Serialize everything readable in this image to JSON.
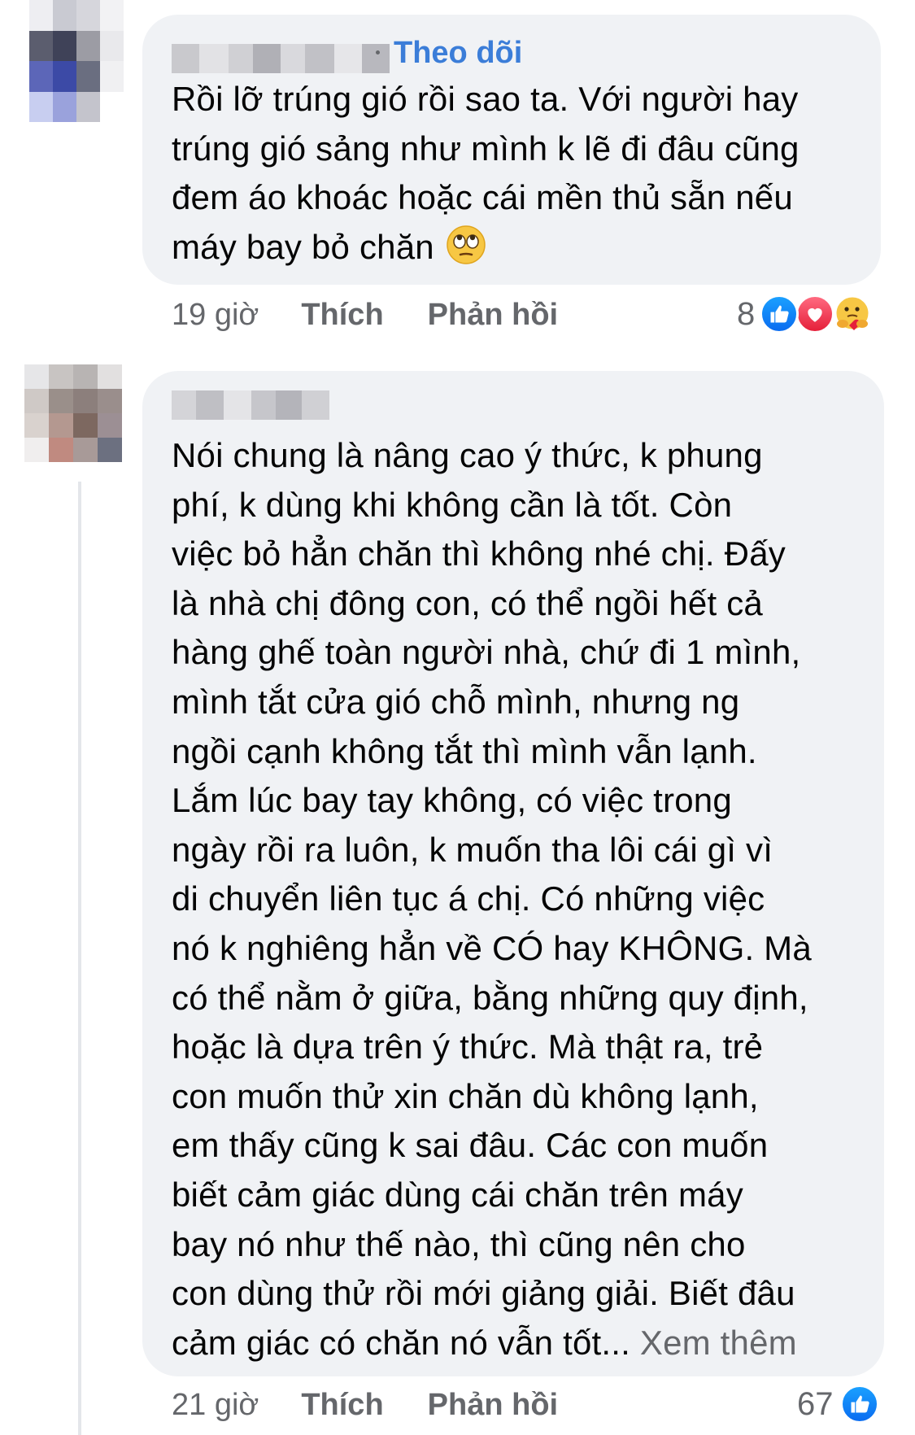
{
  "comments": [
    {
      "follow_label": "Theo dõi",
      "text": "Rồi lỡ trúng gió rồi sao ta. Với người hay\ntrúng gió sảng như mình k lẽ đi đâu cũng\nđem áo khoác hoặc cái mền thủ sẵn nếu\nmáy bay bỏ chăn",
      "emoji": "face-with-rolling-eyes-icon",
      "time": "19 giờ",
      "like_label": "Thích",
      "reply_label": "Phản hồi",
      "reaction_count": "8",
      "reactions": [
        "like-icon",
        "love-icon",
        "care-icon"
      ]
    },
    {
      "text": "Nói chung là nâng cao ý thức, k phung\nphí, k dùng khi không cần là tốt. Còn\nviệc bỏ hẳn chăn thì không nhé chị. Đấy\nlà nhà chị đông con, có thể ngồi hết cả\nhàng ghế toàn người nhà, chứ đi 1 mình,\nmình tắt cửa gió chỗ mình, nhưng ng\nngồi cạnh không tắt thì mình vẫn lạnh.\nLắm lúc bay tay không, có việc trong\nngày rồi ra luôn, k muốn tha lôi cái gì vì\ndi chuyển liên tục á chị. Có những việc\nnó k nghiêng hẳn về CÓ hay KHÔNG. Mà\ncó thể nằm ở giữa, bằng những quy định,\nhoặc là dựa trên ý thức. Mà thật ra, trẻ\ncon muốn thử xin chăn dù không lạnh,\nem thấy cũng k sai đâu. Các con muốn\nbiết cảm giác dùng cái chăn trên máy\nbay nó như thế nào, thì cũng nên cho\ncon dùng thử rồi mới giảng giải. Biết đâu\ncảm giác có chăn nó vẫn tốt...",
      "see_more_label": "Xem thêm",
      "time": "21 giờ",
      "like_label": "Thích",
      "reply_label": "Phản hồi",
      "reaction_count": "67",
      "reactions": [
        "like-icon"
      ]
    }
  ],
  "colors": {
    "bubble": "#f0f2f5",
    "link": "#3b7dd8",
    "meta_text": "#65676b",
    "body_text": "#050505",
    "like": "#0a6cf0",
    "love": "#e5203a"
  }
}
